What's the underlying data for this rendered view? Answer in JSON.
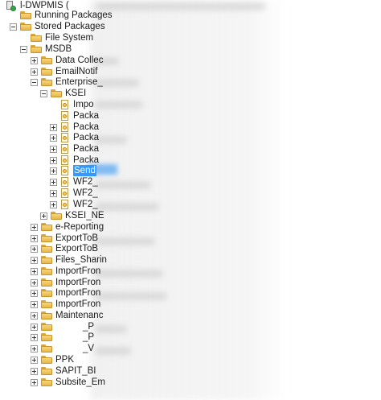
{
  "tree": {
    "server": "l-DWPMIS (",
    "items": [
      {
        "label": "Running Packages"
      },
      {
        "label": "Stored Packages"
      },
      {
        "label": "File System"
      },
      {
        "label": "MSDB"
      },
      {
        "label": "Data Collec"
      },
      {
        "label": "EmailNotif"
      },
      {
        "label": "Enterprise_"
      },
      {
        "label": "KSEI"
      },
      {
        "label": "Impo"
      },
      {
        "label": "Packa"
      },
      {
        "label": "Packa"
      },
      {
        "label": "Packa"
      },
      {
        "label": "Packa"
      },
      {
        "label": "Packa"
      },
      {
        "label": "Send"
      },
      {
        "label": "WF2_"
      },
      {
        "label": "WF2_"
      },
      {
        "label": "WF2_"
      },
      {
        "label": "KSEI_NE"
      },
      {
        "label": "e-Reporting"
      },
      {
        "label": "ExportToB"
      },
      {
        "label": "ExportToB"
      },
      {
        "label": "Files_Sharin"
      },
      {
        "label": "ImportFron"
      },
      {
        "label": "ImportFron"
      },
      {
        "label": "ImportFron"
      },
      {
        "label": "ImportFron"
      },
      {
        "label": "Maintenanc"
      },
      {
        "label": "_P"
      },
      {
        "label": "_P"
      },
      {
        "label": "_V"
      },
      {
        "label": "PPK"
      },
      {
        "label": "SAPIT_BI"
      },
      {
        "label": "Subsite_Em"
      }
    ]
  }
}
